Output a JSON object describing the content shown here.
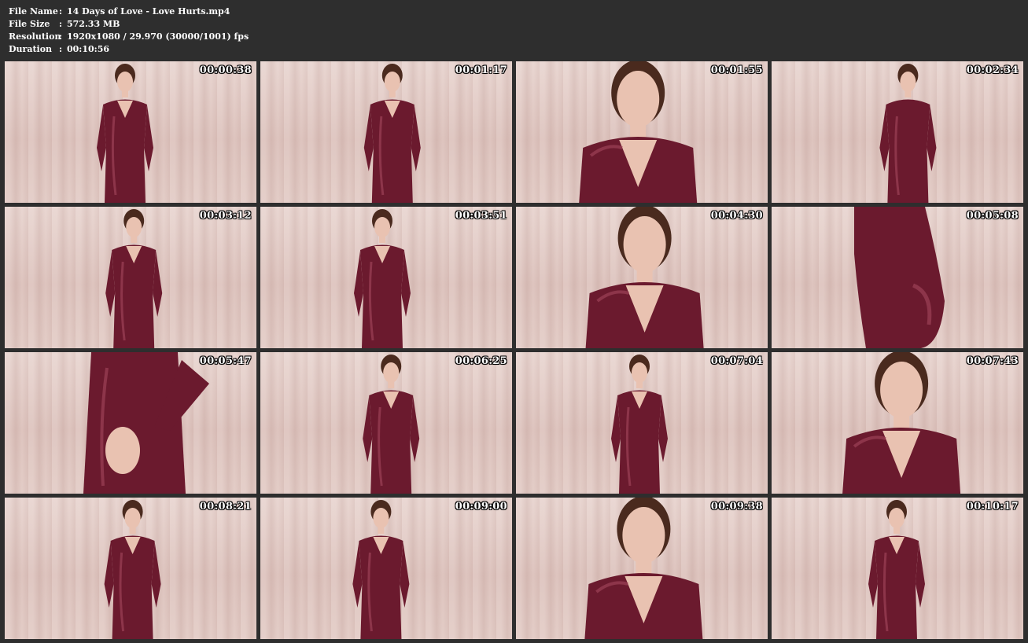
{
  "file_info": {
    "file_name_label": "File Name",
    "file_name": "14 Days of Love - Love Hurts.mp4",
    "file_size_label": "File Size",
    "file_size": "572.33 MB",
    "resolution_label": "Resolution",
    "resolution": "1920x1080 / 29.970 (30000/1001) fps",
    "duration_label": "Duration",
    "duration": "00:10:56",
    "separator": ":"
  },
  "colors": {
    "background": "#2e2e2e",
    "suit": "#6b1a2e",
    "suit_highlight": "#a3485e",
    "skin": "#e9c2b1",
    "hair": "#4a2a1e",
    "curtain": "#e2cac4"
  },
  "thumbnails": [
    {
      "time": "00:00:38",
      "framing": "full"
    },
    {
      "time": "00:01:17",
      "framing": "full"
    },
    {
      "time": "00:01:55",
      "framing": "close"
    },
    {
      "time": "00:02:34",
      "framing": "back"
    },
    {
      "time": "00:03:12",
      "framing": "full"
    },
    {
      "time": "00:03:51",
      "framing": "full"
    },
    {
      "time": "00:04:30",
      "framing": "close"
    },
    {
      "time": "00:05:08",
      "framing": "back-close"
    },
    {
      "time": "00:05:47",
      "framing": "torso"
    },
    {
      "time": "00:06:25",
      "framing": "full"
    },
    {
      "time": "00:07:04",
      "framing": "full"
    },
    {
      "time": "00:07:43",
      "framing": "close"
    },
    {
      "time": "00:08:21",
      "framing": "full"
    },
    {
      "time": "00:09:00",
      "framing": "full"
    },
    {
      "time": "00:09:38",
      "framing": "close"
    },
    {
      "time": "00:10:17",
      "framing": "full"
    }
  ]
}
